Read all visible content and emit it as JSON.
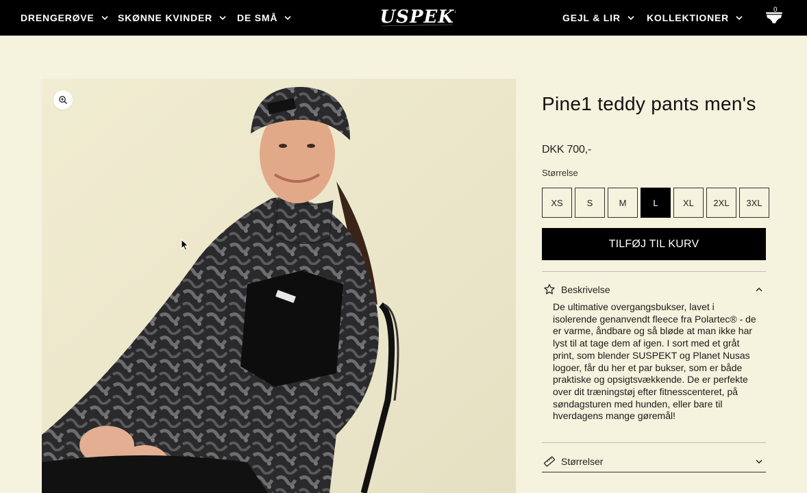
{
  "header": {
    "left_nav": [
      {
        "label": "DRENGERØVE"
      },
      {
        "label": "SKØNNE KVINDER"
      },
      {
        "label": "DE SMÅ"
      }
    ],
    "logo_text": "SUSPEKT",
    "right_nav": [
      {
        "label": "GEJL & LIR"
      },
      {
        "label": "KOLLEKTIONER"
      }
    ],
    "cart_count": "0"
  },
  "product": {
    "title": "Pine1 teddy pants men's",
    "price": "DKK 700,-",
    "size_label": "Størrelse",
    "sizes": [
      "XS",
      "S",
      "M",
      "L",
      "XL",
      "2XL",
      "3XL"
    ],
    "selected_size": "L",
    "add_to_cart": "TILFØJ TIL KURV"
  },
  "accordion": {
    "description": {
      "label": "Beskrivelse",
      "icon": "star-badge-icon",
      "expanded": true,
      "text": "De ultimative overgangsbukser, lavet i isolerende genanvendt fleece fra Polartec® - de er varme, åndbare og så bløde at man ikke har lyst til at tage dem af igen. I sort med et gråt print, som blender SUSPEKT og Planet Nusas logoer, får du her et par bukser, som er både praktiske og opsigtsvækkende.  De er perfekte over dit træningstøj efter fitnesscenteret, på søndagsturen med hunden, eller bare til hverdagens mange gøremål!"
    },
    "sizes": {
      "label": "Størrelser",
      "icon": "ruler-icon",
      "expanded": false
    }
  },
  "colors": {
    "header_bg": "#000000",
    "page_bg": "#f5f2dd",
    "button_bg": "#000000"
  }
}
